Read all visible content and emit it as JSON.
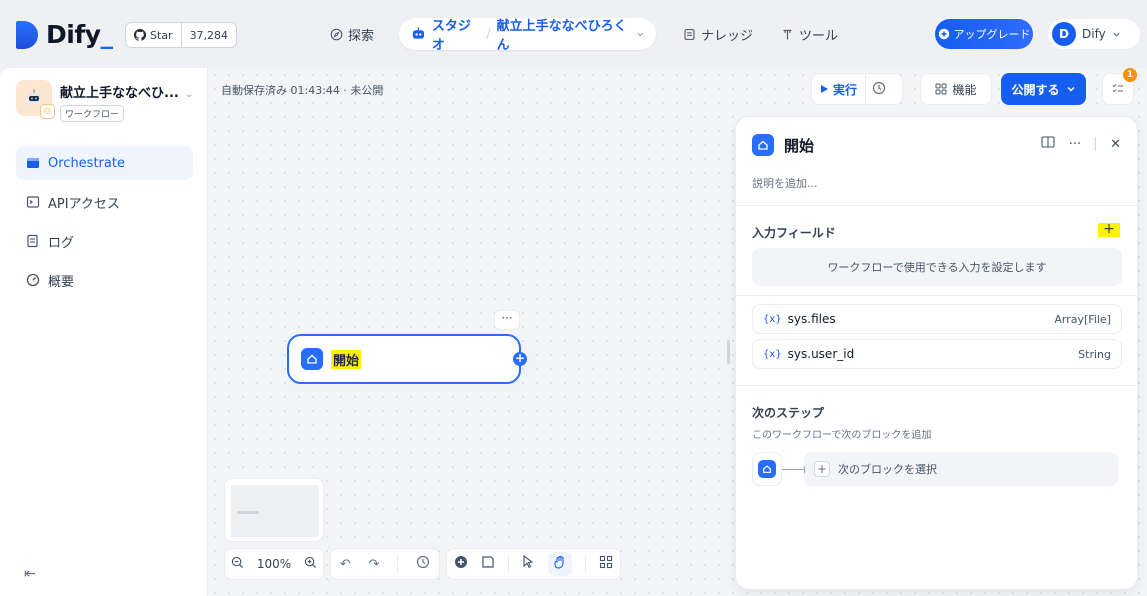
{
  "header": {
    "logo_text": "Dify",
    "github": {
      "star_label": "Star",
      "count": "37,284"
    },
    "nav": {
      "explore": "探索",
      "studio": "スタジオ",
      "separator": "/",
      "app_name": "献立上手ななべひろくん",
      "knowledge": "ナレッジ",
      "tools": "ツール"
    },
    "upgrade_label": "アップグレード",
    "user": {
      "initial": "D",
      "name": "Dify"
    }
  },
  "sidebar": {
    "app_name": "献立上手ななべひ...",
    "app_type": "ワークフロー",
    "items": [
      {
        "label": "Orchestrate",
        "icon": "layout-icon",
        "active": true
      },
      {
        "label": "APIアクセス",
        "icon": "terminal-icon",
        "active": false
      },
      {
        "label": "ログ",
        "icon": "log-icon",
        "active": false
      },
      {
        "label": "概要",
        "icon": "gauge-icon",
        "active": false
      }
    ]
  },
  "toolbar": {
    "autosave_status": "自動保存済み 01:43:44 · 未公開",
    "run_label": "実行",
    "features_label": "機能",
    "publish_label": "公開する",
    "checklist_count": "1"
  },
  "node": {
    "title": "開始",
    "more": "···"
  },
  "controls": {
    "zoom": "100%"
  },
  "panel": {
    "title": "開始",
    "description_placeholder": "説明を追加...",
    "input_fields_title": "入力フィールド",
    "input_fields_empty": "ワークフローで使用できる入力を設定します",
    "variables": [
      {
        "icon": "{x}",
        "name": "sys.files",
        "type": "Array[File]"
      },
      {
        "icon": "{x}",
        "name": "sys.user_id",
        "type": "String"
      }
    ],
    "next_step_title": "次のステップ",
    "next_step_desc": "このワークフローで次のブロックを追加",
    "next_step_select": "次のブロックを選択"
  },
  "colors": {
    "primary": "#155eef",
    "node_border": "#296dff",
    "highlight": "#fff200",
    "checklist_badge": "#f79009"
  }
}
